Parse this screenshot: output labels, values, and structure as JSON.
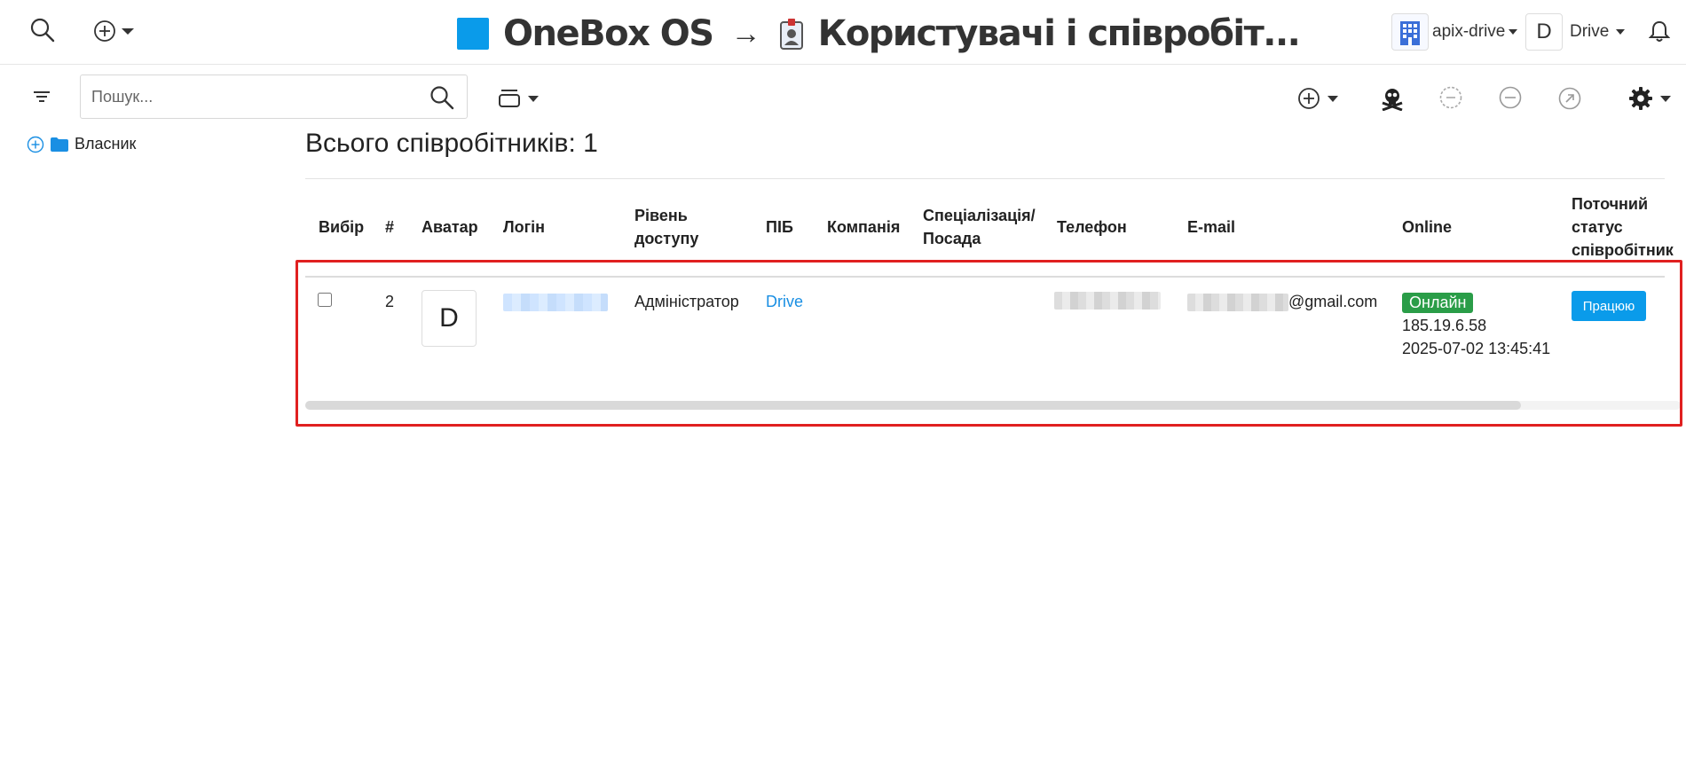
{
  "header": {
    "app_name": "OneBox OS",
    "arrow": "→",
    "page_name": "Користувачі і співробіт...",
    "account_name": "apix-drive",
    "user_initial": "D",
    "user_name": "Drive"
  },
  "toolbar": {
    "search_placeholder": "Пошук..."
  },
  "sidebar": {
    "owner_label": "Власник"
  },
  "main": {
    "total_label": "Всього співробітників: 1"
  },
  "table": {
    "headers": {
      "select": "Вибір",
      "num": "#",
      "avatar": "Аватар",
      "login": "Логін",
      "access_1": "Рівень",
      "access_2": "доступу",
      "fio": "ПІБ",
      "company": "Компанія",
      "spec_1": "Спеціалізація/",
      "spec_2": "Посада",
      "phone": "Телефон",
      "email": "E-mail",
      "online": "Online",
      "status_1": "Поточний",
      "status_2": "статус",
      "status_3": "співробітник"
    },
    "rows": [
      {
        "num": "2",
        "avatar_initial": "D",
        "access_level": "Адміністратор",
        "fio": "Drive",
        "email_domain": "@gmail.com",
        "online_badge": "Онлайн",
        "ip": "185.19.6.58",
        "last_seen": "2025-07-02 13:45:41",
        "status_button": "Працюю"
      }
    ]
  },
  "colors": {
    "accent": "#0a9bea",
    "online": "#2a9d48",
    "link": "#1a8fe3",
    "highlight": "#e02020"
  }
}
